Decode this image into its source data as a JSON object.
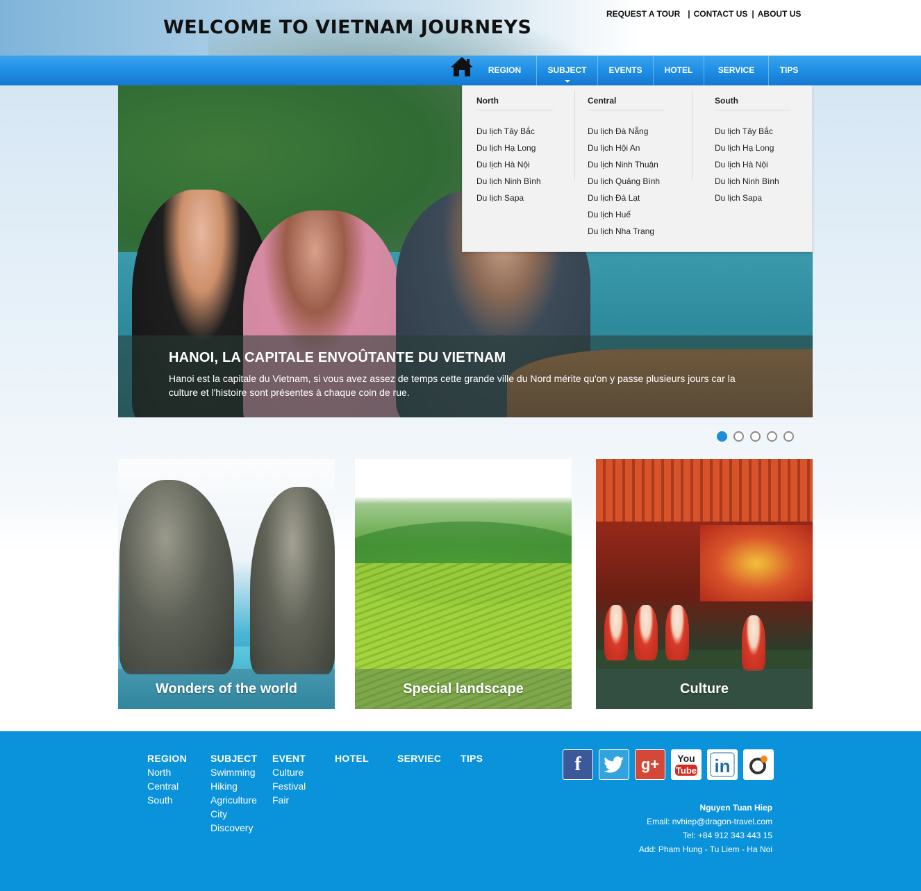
{
  "header": {
    "site_title": "WELCOME TO VIETNAM JOURNEYS",
    "top_links": [
      "REQUEST A TOUR",
      "CONTACT US",
      "ABOUT US"
    ],
    "top_separator": "|"
  },
  "nav": {
    "home_icon": "home-icon",
    "items": [
      {
        "label": "REGION"
      },
      {
        "label": "SUBJECT",
        "active": true
      },
      {
        "label": "EVENTS"
      },
      {
        "label": "HOTEL"
      },
      {
        "label": "SERVICE"
      },
      {
        "label": "TIPS"
      }
    ]
  },
  "dropdown": {
    "columns": [
      {
        "heading": "North",
        "items": [
          "Du lịch Tây Bắc",
          "Du lịch Hạ Long",
          "Du lịch Hà Nội",
          "Du lịch Ninh Bình",
          "Du lịch Sapa"
        ]
      },
      {
        "heading": "Central",
        "items": [
          "Du lịch Đà Nẵng",
          "Du lịch Hội An",
          "Du lịch Ninh Thuận",
          "Du lịch Quảng Bình",
          "Du lịch Đà Lạt",
          "Du lịch Huế",
          "Du lịch Nha Trang"
        ]
      },
      {
        "heading": "South",
        "items": [
          "Du lịch Tây Bắc",
          "Du lịch Hạ Long",
          "Du lịch Hà Nội",
          "Du lịch Ninh Bình",
          "Du lịch Sapa"
        ]
      }
    ]
  },
  "hero": {
    "title": "HANOI, LA CAPITALE ENVOÛTANTE DU VIETNAM",
    "description": "Hanoi est la capitale du Vietnam, si vous avez assez de temps cette grande ville du Nord mérite qu'on y passe plusieurs jours car la culture et l'histoire sont présentes à chaque coin de rue.",
    "slide_count": 5,
    "active_slide": 1
  },
  "cards": [
    {
      "caption": "Wonders of the world"
    },
    {
      "caption": "Special landscape"
    },
    {
      "caption": "Culture"
    }
  ],
  "footer": {
    "columns": [
      {
        "heading": "REGION",
        "items": [
          "North",
          "Central",
          "South"
        ]
      },
      {
        "heading": "SUBJECT",
        "items": [
          "Swimming",
          "Hiking",
          "Agriculture",
          "City",
          "Discovery"
        ]
      },
      {
        "heading": "EVENT",
        "items": [
          "Culture",
          "Festival",
          "Fair"
        ]
      },
      {
        "heading": "HOTEL",
        "items": []
      },
      {
        "heading": "SERVIEC",
        "items": []
      },
      {
        "heading": "TIPS",
        "items": []
      }
    ],
    "social": [
      "facebook-icon",
      "twitter-icon",
      "google-plus-icon",
      "youtube-icon",
      "linkedin-icon",
      "orkut-icon"
    ],
    "contact": {
      "name": "Nguyen Tuan Hiep",
      "email": "Email: nvhiep@dragon-travel.com",
      "tel": "Tel: +84 912 343 443 15",
      "address": "Add: Pham Hung - Tu Liem - Ha Noi"
    }
  },
  "colors": {
    "nav_blue": "#1f8fe6",
    "footer_blue": "#0a93da",
    "dot_active": "#1d8fd6"
  }
}
